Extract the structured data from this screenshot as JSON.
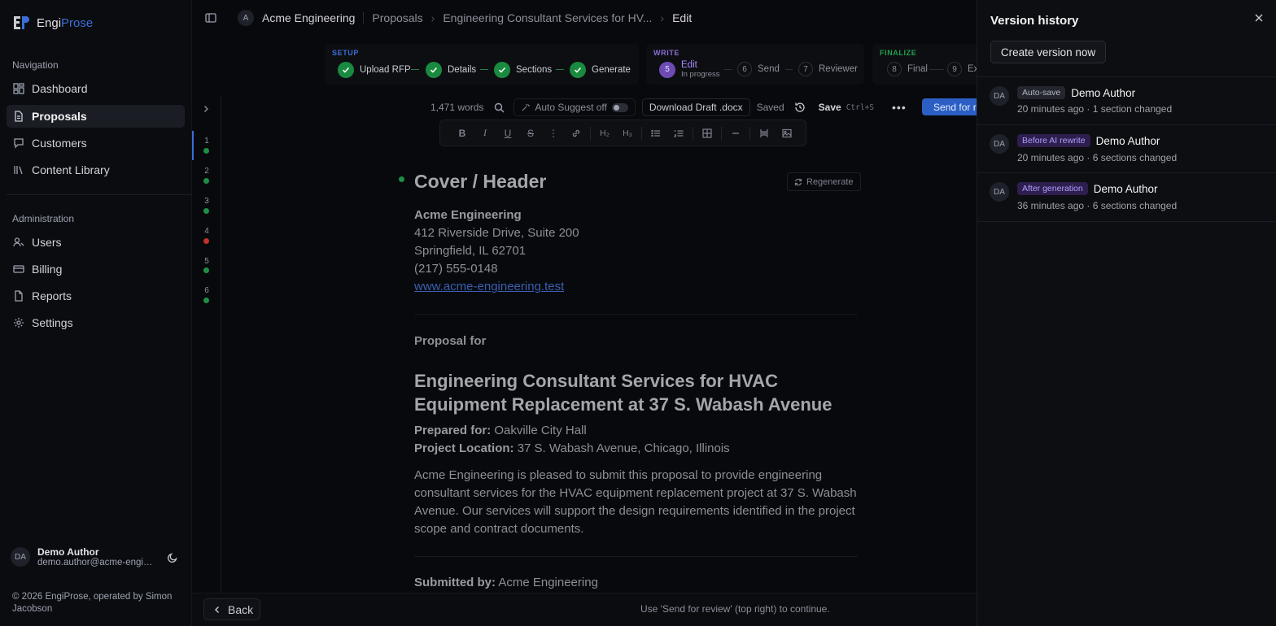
{
  "brand": {
    "name_a": "Engi",
    "name_b": "Prose"
  },
  "sidebar": {
    "nav_title": "Navigation",
    "nav_items": [
      {
        "label": "Dashboard",
        "icon": "dashboard-icon"
      },
      {
        "label": "Proposals",
        "icon": "document-icon",
        "active": true
      },
      {
        "label": "Customers",
        "icon": "chat-icon"
      },
      {
        "label": "Content Library",
        "icon": "library-icon"
      }
    ],
    "admin_title": "Administration",
    "admin_items": [
      {
        "label": "Users",
        "icon": "users-icon"
      },
      {
        "label": "Billing",
        "icon": "card-icon"
      },
      {
        "label": "Reports",
        "icon": "file-icon"
      },
      {
        "label": "Settings",
        "icon": "gear-icon"
      }
    ],
    "user": {
      "initials": "DA",
      "name": "Demo Author",
      "email": "demo.author@acme-engineering.test"
    },
    "copyright": "© 2026 EngiProse, operated by Simon Jacobson"
  },
  "breadcrumb": {
    "org_initial": "A",
    "org": "Acme Engineering",
    "proposals": "Proposals",
    "proposal": "Engineering Consultant Services for HV...",
    "current": "Edit"
  },
  "stepper": {
    "setup_label": "SETUP",
    "write_label": "WRITE",
    "finalize_label": "FINALIZE",
    "setup_steps": [
      "Upload RFP",
      "Details",
      "Sections",
      "Generate"
    ],
    "edit_num": "5",
    "edit_label": "Edit",
    "edit_sub": "In progress",
    "send_num": "6",
    "send_label": "Send",
    "reviewer_num": "7",
    "reviewer_label": "Reviewer",
    "final_num": "8",
    "final_label": "Final",
    "export_num": "9",
    "export_label": "Ex"
  },
  "rail": {
    "items": [
      "1",
      "2",
      "3",
      "4",
      "5",
      "6"
    ]
  },
  "toolbar": {
    "word_count": "1,471 words",
    "auto_suggest": "Auto Suggest off",
    "download": "Download Draft .docx",
    "saved": "Saved",
    "save": "Save",
    "shortcut": "Ctrl+S",
    "send": "Send for review"
  },
  "format": {
    "h2": "H₂",
    "h3": "H₃"
  },
  "document": {
    "cover_heading": "Cover / Header",
    "regenerate": "Regenerate",
    "company": "Acme Engineering",
    "address1": "412 Riverside Drive, Suite 200",
    "address2": "Springfield, IL 62701",
    "phone": "(217) 555-0148",
    "website": "www.acme-engineering.test",
    "proposal_for": "Proposal for",
    "title": "Engineering Consultant Services for HVAC Equipment Replacement at 37 S. Wabash Avenue",
    "prepared_label": "Prepared for:",
    "prepared_value": "Oakville City Hall",
    "location_label": "Project Location:",
    "location_value": "37 S. Wabash Avenue, Chicago, Illinois",
    "intro": "Acme Engineering is pleased to submit this proposal to provide engineering consultant services for the HVAC equipment replacement project at 37 S. Wabash Avenue. Our services will support the design requirements identified in the project scope and contract documents.",
    "submitted_label": "Submitted by:",
    "submitted_value": "Acme Engineering"
  },
  "bottom": {
    "back": "Back",
    "hint": "Use 'Send for review' (top right) to continue."
  },
  "version_history": {
    "title": "Version history",
    "create": "Create version now",
    "items": [
      {
        "initials": "DA",
        "tag": "Auto-save",
        "author": "Demo Author",
        "time": "20 minutes ago",
        "changes": "1 section changed"
      },
      {
        "initials": "DA",
        "tag": "Before AI rewrite",
        "author": "Demo Author",
        "time": "20 minutes ago",
        "changes": "6 sections changed"
      },
      {
        "initials": "DA",
        "tag": "After generation",
        "author": "Demo Author",
        "time": "36 minutes ago",
        "changes": "6 sections changed"
      }
    ]
  },
  "colors": {
    "accent": "#3b6fd6",
    "success": "#198a3f",
    "purple": "#6d4bb3",
    "danger": "#c0312b"
  }
}
